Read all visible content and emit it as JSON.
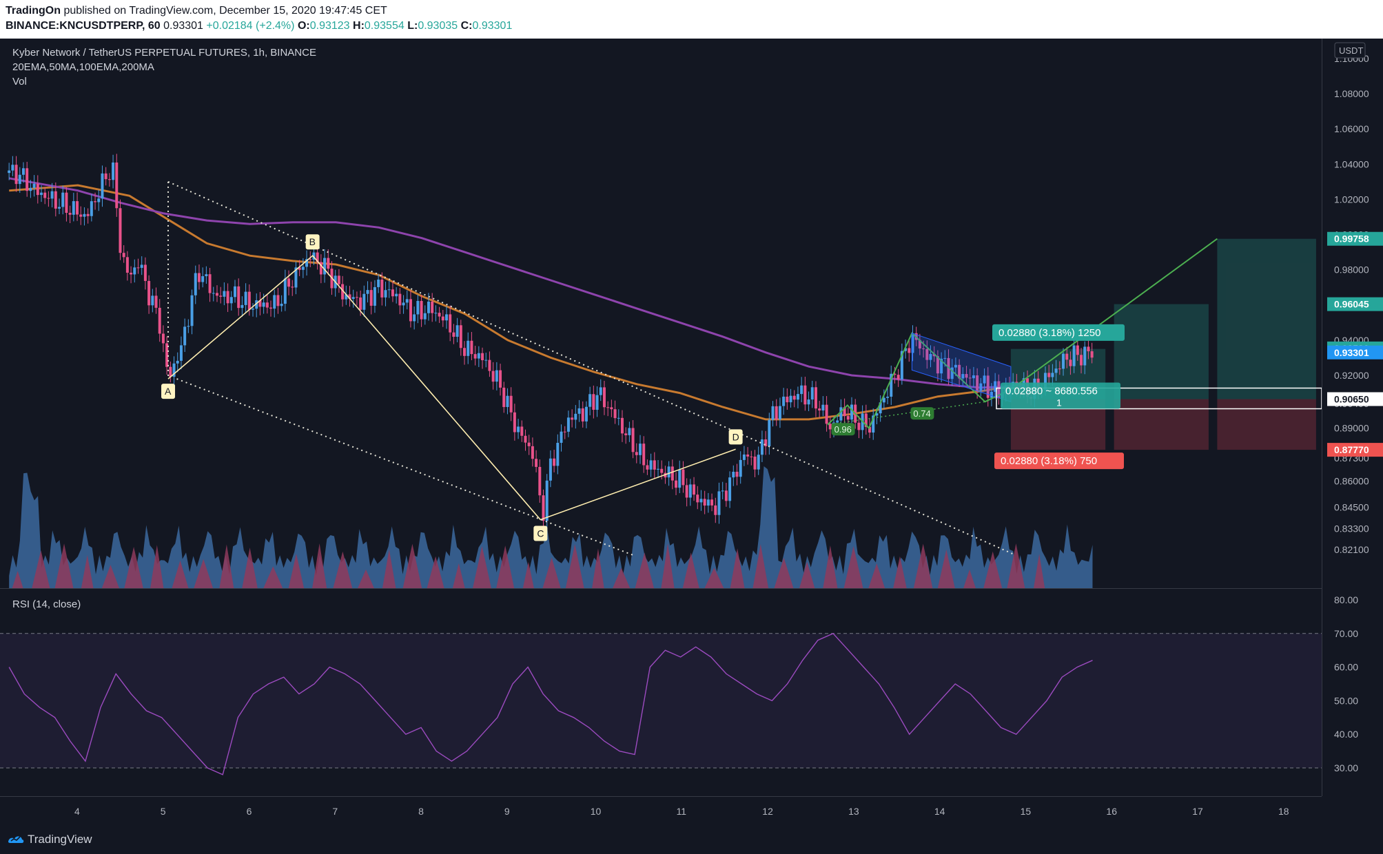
{
  "header": {
    "publisher": "TradingOn",
    "published_text": "published on TradingView.com, December 15, 2020 19:47:45 CET",
    "symbol_line": "BINANCE:KNCUSDTPERP, 60",
    "last": "0.93301",
    "change": "+0.02184 (+2.4%)",
    "o_label": "O:",
    "o": "0.93123",
    "h_label": "H:",
    "h": "0.93554",
    "l_label": "L:",
    "l": "0.93035",
    "c_label": "C:",
    "c": "0.93301"
  },
  "legend": {
    "title": "Kyber Network / TetherUS PERPETUAL FUTURES, 1h, BINANCE",
    "indicators": "20EMA,50MA,100EMA,200MA",
    "volume": "Vol",
    "rsi": "RSI (14, close)"
  },
  "footer": {
    "brand": "TradingView"
  },
  "colors": {
    "background": "#131722",
    "up": "#26a69a",
    "down": "#ef5350",
    "candle_up": "#4a9fe6",
    "candle_down": "#e8528a",
    "ma_orange": "#c87a2f",
    "ma_purple": "#8e44ad",
    "rsi_line": "#9c4bc0"
  },
  "chart_data": [
    {
      "type": "candlestick",
      "title": "Kyber Network / TetherUS PERPETUAL FUTURES, 1h, BINANCE",
      "currency": "USDT",
      "x_ticks": [
        "4",
        "5",
        "6",
        "7",
        "8",
        "9",
        "10",
        "11",
        "12",
        "13",
        "14",
        "15",
        "16",
        "17",
        "18"
      ],
      "y_ticks": [
        "0.82100",
        "0.83300",
        "0.84500",
        "0.86000",
        "0.87300",
        "0.89000",
        "0.90400",
        "0.92000",
        "0.94000",
        "0.96000",
        "0.98000",
        "1.00000",
        "1.02000",
        "1.04000",
        "1.06000",
        "1.08000",
        "1.10000"
      ],
      "ylim": [
        0.815,
        1.1
      ],
      "price_labels": [
        {
          "text": "0.99758",
          "color": "#26a69a"
        },
        {
          "text": "0.96045",
          "color": "#26a69a"
        },
        {
          "text": "0.93530",
          "color": "#26a69a"
        },
        {
          "text": "0.93301",
          "color": "#2196f3"
        },
        {
          "text": "0.90650",
          "color": "#ffffff"
        },
        {
          "text": "0.87770",
          "color": "#ef5350"
        }
      ],
      "close_path_points": [
        [
          "3.3",
          1.035
        ],
        [
          "3.5",
          1.025
        ],
        [
          "3.7",
          1.02
        ],
        [
          "3.9",
          1.015
        ],
        [
          "4.1",
          1.01
        ],
        [
          "4.3",
          1.03
        ],
        [
          "4.4",
          1.04
        ],
        [
          "4.5",
          0.99
        ],
        [
          "4.6",
          0.975
        ],
        [
          "4.7",
          0.985
        ],
        [
          "4.8",
          0.97
        ],
        [
          "4.95",
          0.95
        ],
        [
          "5.05",
          0.918
        ],
        [
          "5.2",
          0.935
        ],
        [
          "5.4",
          0.98
        ],
        [
          "5.6",
          0.965
        ],
        [
          "5.8",
          0.965
        ],
        [
          "6.0",
          0.96
        ],
        [
          "6.3",
          0.96
        ],
        [
          "6.5",
          0.975
        ],
        [
          "6.7",
          0.988
        ],
        [
          "6.9",
          0.98
        ],
        [
          "7.1",
          0.965
        ],
        [
          "7.3",
          0.962
        ],
        [
          "7.5",
          0.97
        ],
        [
          "7.7",
          0.965
        ],
        [
          "7.9",
          0.955
        ],
        [
          "8.1",
          0.958
        ],
        [
          "8.3",
          0.95
        ],
        [
          "8.5",
          0.935
        ],
        [
          "8.7",
          0.93
        ],
        [
          "8.9",
          0.915
        ],
        [
          "9.1",
          0.89
        ],
        [
          "9.3",
          0.875
        ],
        [
          "9.4",
          0.84
        ],
        [
          "9.5",
          0.87
        ],
        [
          "9.7",
          0.895
        ],
        [
          "9.9",
          0.9
        ],
        [
          "10.05",
          0.91
        ],
        [
          "10.2",
          0.9
        ],
        [
          "10.4",
          0.885
        ],
        [
          "10.6",
          0.87
        ],
        [
          "10.8",
          0.865
        ],
        [
          "11.0",
          0.86
        ],
        [
          "11.2",
          0.85
        ],
        [
          "11.4",
          0.845
        ],
        [
          "11.6",
          0.86
        ],
        [
          "11.75",
          0.875
        ],
        [
          "11.9",
          0.87
        ],
        [
          "12.05",
          0.895
        ],
        [
          "12.2",
          0.905
        ],
        [
          "12.4",
          0.91
        ],
        [
          "12.6",
          0.905
        ],
        [
          "12.75",
          0.89
        ],
        [
          "12.9",
          0.9
        ],
        [
          "13.05",
          0.895
        ],
        [
          "13.2",
          0.89
        ],
        [
          "13.4",
          0.91
        ],
        [
          "13.55",
          0.925
        ],
        [
          "13.7",
          0.942
        ],
        [
          "13.9",
          0.93
        ],
        [
          "14.1",
          0.925
        ],
        [
          "14.3",
          0.92
        ],
        [
          "14.5",
          0.915
        ],
        [
          "14.7",
          0.91
        ],
        [
          "14.9",
          0.915
        ],
        [
          "15.1",
          0.91
        ],
        [
          "15.3",
          0.92
        ],
        [
          "15.5",
          0.93
        ],
        [
          "15.8",
          0.933
        ]
      ],
      "series": [
        {
          "kind": "ma",
          "color": "#c87a2f",
          "points": [
            [
              "3.2",
              1.025
            ],
            [
              "4.0",
              1.028
            ],
            [
              "4.6",
              1.022
            ],
            [
              "5.0",
              1.01
            ],
            [
              "5.5",
              0.995
            ],
            [
              "6.0",
              0.988
            ],
            [
              "6.5",
              0.985
            ],
            [
              "7.0",
              0.983
            ],
            [
              "7.5",
              0.977
            ],
            [
              "8.0",
              0.965
            ],
            [
              "8.5",
              0.955
            ],
            [
              "9.0",
              0.94
            ],
            [
              "9.5",
              0.93
            ],
            [
              "10.0",
              0.922
            ],
            [
              "10.5",
              0.915
            ],
            [
              "11.0",
              0.91
            ],
            [
              "11.5",
              0.902
            ],
            [
              "12.0",
              0.895
            ],
            [
              "12.5",
              0.895
            ],
            [
              "13.0",
              0.898
            ],
            [
              "13.5",
              0.902
            ],
            [
              "14.0",
              0.908
            ],
            [
              "14.5",
              0.911
            ],
            [
              "15.0",
              0.915
            ]
          ]
        },
        {
          "kind": "ma",
          "color": "#8e44ad",
          "points": [
            [
              "3.2",
              1.032
            ],
            [
              "4.0",
              1.025
            ],
            [
              "4.5",
              1.018
            ],
            [
              "5.0",
              1.012
            ],
            [
              "5.5",
              1.008
            ],
            [
              "6.0",
              1.006
            ],
            [
              "6.5",
              1.007
            ],
            [
              "7.0",
              1.007
            ],
            [
              "7.5",
              1.004
            ],
            [
              "8.0",
              0.998
            ],
            [
              "8.5",
              0.99
            ],
            [
              "9.0",
              0.982
            ],
            [
              "9.5",
              0.974
            ],
            [
              "10.0",
              0.966
            ],
            [
              "10.5",
              0.958
            ],
            [
              "11.0",
              0.95
            ],
            [
              "11.5",
              0.942
            ],
            [
              "12.0",
              0.933
            ],
            [
              "12.5",
              0.925
            ],
            [
              "13.0",
              0.92
            ],
            [
              "13.5",
              0.918
            ],
            [
              "14.0",
              0.915
            ],
            [
              "14.5",
              0.913
            ],
            [
              "15.0",
              0.914
            ]
          ]
        }
      ],
      "annotations": {
        "abcd": [
          {
            "label": "A",
            "x": "5.05",
            "y": 0.918
          },
          {
            "label": "B",
            "x": "6.73",
            "y": 0.988
          },
          {
            "label": "C",
            "x": "9.38",
            "y": 0.838
          },
          {
            "label": "D",
            "x": "11.65",
            "y": 0.878
          }
        ],
        "pattern_labels": [
          "0.96",
          "0.74"
        ],
        "position_box": {
          "target_label": "0.02880 (3.18%) 1250",
          "stop_label": "0.02880 (3.18%) 750",
          "entry_label": "0.02880 ~ 8680.556",
          "entry_sub": "1"
        }
      }
    },
    {
      "type": "line",
      "title": "RSI (14, close)",
      "y_ticks": [
        "30.00",
        "40.00",
        "50.00",
        "60.00",
        "70.00",
        "80.00"
      ],
      "ylim": [
        25,
        82
      ],
      "bands": [
        30,
        70
      ],
      "values_sample": [
        60,
        52,
        48,
        45,
        38,
        32,
        48,
        58,
        52,
        47,
        45,
        40,
        35,
        30,
        28,
        45,
        52,
        55,
        57,
        52,
        55,
        60,
        58,
        55,
        50,
        45,
        40,
        42,
        35,
        32,
        35,
        40,
        45,
        55,
        60,
        52,
        47,
        45,
        42,
        38,
        35,
        34,
        60,
        65,
        63,
        66,
        63,
        58,
        55,
        52,
        50,
        55,
        62,
        68,
        70,
        65,
        60,
        55,
        48,
        40,
        45,
        50,
        55,
        52,
        47,
        42,
        40,
        45,
        50,
        57,
        60,
        62
      ]
    }
  ]
}
